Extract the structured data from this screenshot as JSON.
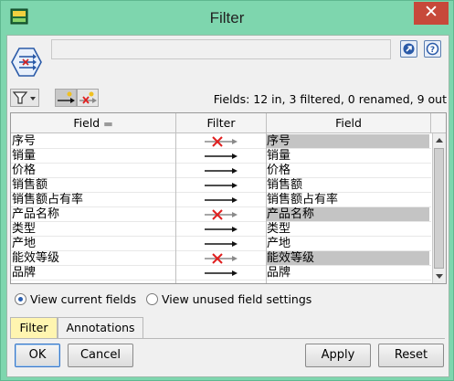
{
  "window": {
    "title": "Filter",
    "close_glyph": "✕",
    "icon": "node-app-icon"
  },
  "header": {
    "node_icon": "filter-node-icon",
    "name_value": "",
    "icons": [
      "open-node-icon",
      "help-icon"
    ]
  },
  "toolbar": {
    "filter_menu_icon": "funnel-icon",
    "tool_icons": [
      "pass-all-icon",
      "discard-all-icon"
    ],
    "summary": "Fields: 12 in, 3 filtered, 0 renamed, 9 out"
  },
  "grid": {
    "headers": [
      "Field",
      "Filter",
      "Field"
    ],
    "rows": [
      {
        "input": "序号",
        "output": "序号",
        "filtered": true
      },
      {
        "input": "销量",
        "output": "销量",
        "filtered": false
      },
      {
        "input": "价格",
        "output": "价格",
        "filtered": false
      },
      {
        "input": "销售额",
        "output": "销售额",
        "filtered": false
      },
      {
        "input": "销售额占有率",
        "output": "销售额占有率",
        "filtered": false
      },
      {
        "input": "产品名称",
        "output": "产品名称",
        "filtered": true
      },
      {
        "input": "类型",
        "output": "类型",
        "filtered": false
      },
      {
        "input": "产地",
        "output": "产地",
        "filtered": false
      },
      {
        "input": "能效等级",
        "output": "能效等级",
        "filtered": true
      },
      {
        "input": "品牌",
        "output": "品牌",
        "filtered": false
      }
    ]
  },
  "view_options": {
    "current": "View current fields",
    "unused": "View unused field settings",
    "selected": "current"
  },
  "tabs": [
    {
      "label": "Filter",
      "active": true
    },
    {
      "label": "Annotations",
      "active": false
    }
  ],
  "buttons": {
    "ok": "OK",
    "cancel": "Cancel",
    "apply": "Apply",
    "reset": "Reset"
  },
  "colors": {
    "title_bar": "#7ed6ae",
    "close": "#c7493a",
    "filtered_cell": "#c4c4c4",
    "cross": "#e02020",
    "active_tab": "#fff5b0"
  }
}
